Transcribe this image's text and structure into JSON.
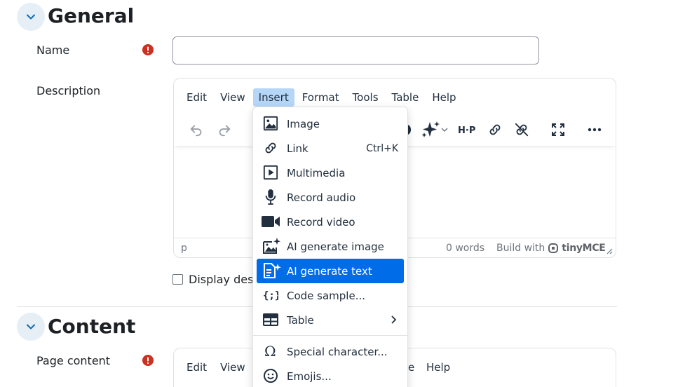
{
  "sections": {
    "general": {
      "title": "General"
    },
    "content": {
      "title": "Content"
    }
  },
  "fields": {
    "name": {
      "label": "Name",
      "value": "",
      "placeholder": ""
    },
    "description": {
      "label": "Description"
    },
    "display_description": {
      "label": "Display description on course page",
      "checked": false
    },
    "page_content": {
      "label": "Page content"
    }
  },
  "editor": {
    "menus": [
      "Edit",
      "View",
      "Insert",
      "Format",
      "Tools",
      "Table",
      "Help"
    ],
    "active_menu": "Insert",
    "status_path": "p",
    "word_count": "0 words",
    "build_with": "Build with",
    "brand": "tinyMCE"
  },
  "editor2": {
    "menus_left": [
      "Edit",
      "View"
    ],
    "menus_right_partial": "e",
    "menu_help": "Help"
  },
  "insert_menu": {
    "items": [
      {
        "label": "Image",
        "icon": "image-icon",
        "shortcut": ""
      },
      {
        "label": "Link",
        "icon": "link-icon",
        "shortcut": "Ctrl+K"
      },
      {
        "label": "Multimedia",
        "icon": "multimedia-icon",
        "shortcut": ""
      },
      {
        "label": "Record audio",
        "icon": "microphone-icon",
        "shortcut": ""
      },
      {
        "label": "Record video",
        "icon": "video-camera-icon",
        "shortcut": ""
      },
      {
        "label": "AI generate image",
        "icon": "ai-image-icon",
        "shortcut": ""
      },
      {
        "label": "AI generate text",
        "icon": "ai-text-icon",
        "shortcut": ""
      },
      {
        "label": "Code sample...",
        "icon": "code-sample-icon",
        "shortcut": ""
      },
      {
        "label": "Table",
        "icon": "table-icon",
        "shortcut": ""
      },
      {
        "label": "Special character...",
        "icon": "omega-icon",
        "shortcut": ""
      },
      {
        "label": "Emojis...",
        "icon": "emoji-icon",
        "shortcut": ""
      }
    ],
    "highlighted": "AI generate text"
  },
  "colors": {
    "accent": "#006ce7",
    "menu_active_bg": "#b6d6f7",
    "required": "#ca3120",
    "section_toggle_bg": "#e6eef6",
    "link": "#0f6cbf"
  }
}
